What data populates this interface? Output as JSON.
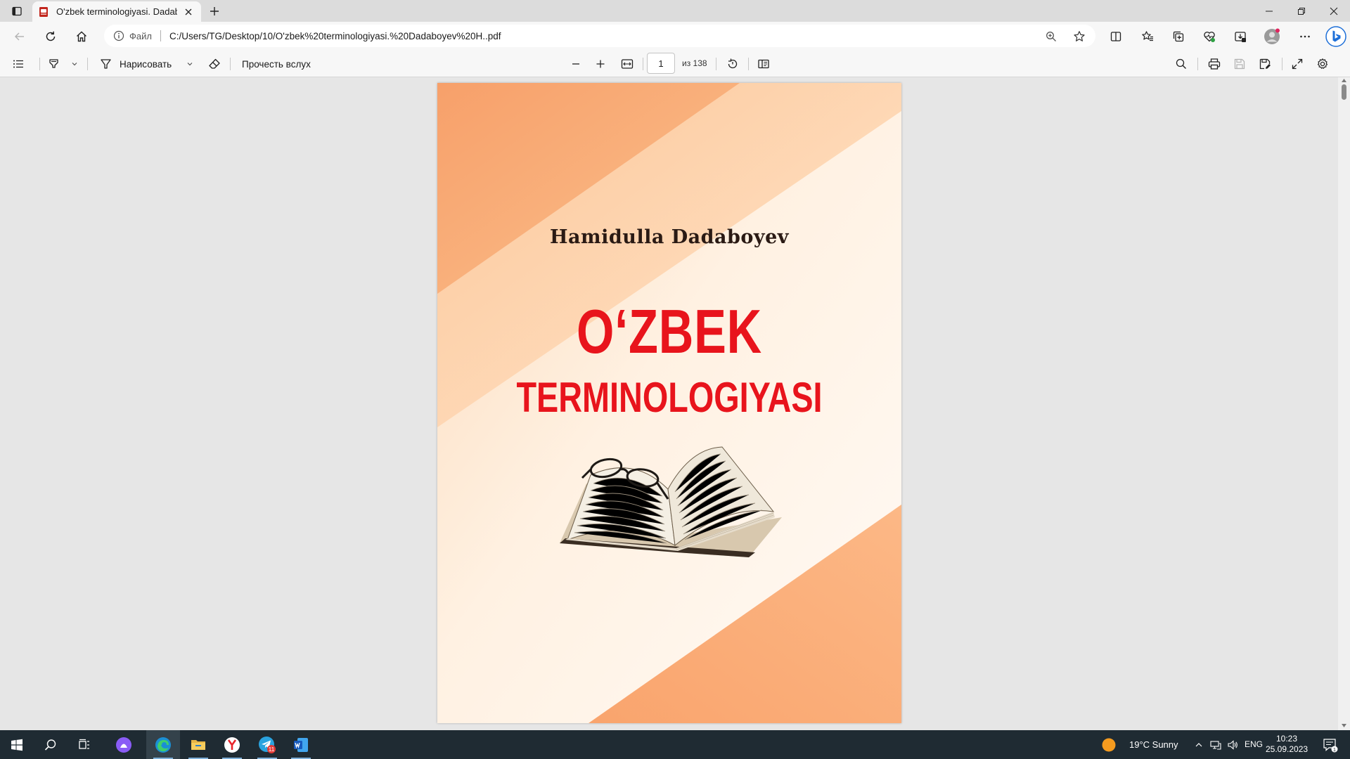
{
  "browser": {
    "tab": {
      "title": "O'zbek terminologiyasi. Dadaboyev",
      "favicon": "pdf-icon"
    },
    "address": {
      "scheme_label": "Файл",
      "url": "C:/Users/TG/Desktop/10/O'zbek%20terminologiyasi.%20Dadaboyev%20H..pdf"
    }
  },
  "pdf_toolbar": {
    "draw_label": "Нарисовать",
    "read_aloud_label": "Прочесть вслух",
    "page_current": "1",
    "page_total": "из 138"
  },
  "document": {
    "author": "Hamidulla Dadaboyev",
    "title_line1": "O‘ZBEK",
    "title_line2": "TERMINOLOGIYASI",
    "colors": {
      "title": "#e8141c",
      "cover_orange": "#f9a774",
      "cover_light": "#fff6ee"
    }
  },
  "taskbar": {
    "weather": "19°C  Sunny",
    "language": "ENG",
    "time": "10:23",
    "date": "25.09.2023",
    "telegram_badge": "11",
    "notification_count": "1"
  }
}
